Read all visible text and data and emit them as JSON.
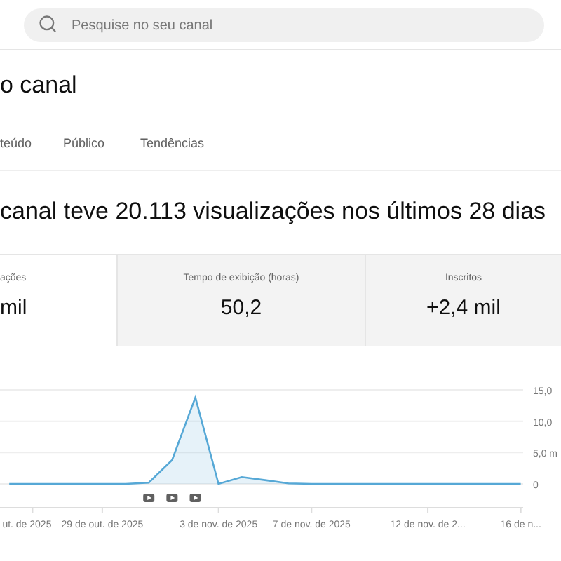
{
  "search": {
    "placeholder": "Pesquise no seu canal"
  },
  "page_title": "o canal",
  "tabs": [
    {
      "label": "teúdo",
      "selected": false
    },
    {
      "label": "Público",
      "selected": false
    },
    {
      "label": "Tendências",
      "selected": false
    }
  ],
  "headline": "canal teve 20.113 visualizações nos últimos 28 dias",
  "metrics": [
    {
      "label": "ações",
      "value": "mil",
      "selected": true
    },
    {
      "label": "Tempo de exibição (horas)",
      "value": "50,2",
      "selected": false
    },
    {
      "label": "Inscritos",
      "value": "+2,4 mil",
      "selected": false
    }
  ],
  "chart": {
    "chart_data": {
      "type": "area",
      "series": [
        {
          "color": "#56a8d6",
          "values": [
            0,
            0,
            0,
            0,
            0,
            0,
            0.2,
            3.8,
            13.8,
            0,
            1.1,
            0.6,
            0.1,
            0,
            0,
            0,
            0,
            0,
            0,
            0,
            0,
            0,
            0
          ]
        }
      ],
      "ylim": [
        0,
        15
      ],
      "categories": [
        null,
        "ut. de 2025",
        null,
        null,
        "29 de out. de 2025",
        null,
        null,
        null,
        null,
        "3 de nov. de 2025",
        null,
        null,
        null,
        "7 de nov. de 2025",
        null,
        null,
        null,
        null,
        "12 de nov. de 2...",
        null,
        null,
        null,
        "16 de n..."
      ],
      "yticks": [
        {
          "value": 0,
          "label": "0"
        },
        {
          "value": 5,
          "label": "5,0 m"
        },
        {
          "value": 10,
          "label": "10,0"
        },
        {
          "value": 15,
          "label": "15,0"
        }
      ]
    }
  }
}
